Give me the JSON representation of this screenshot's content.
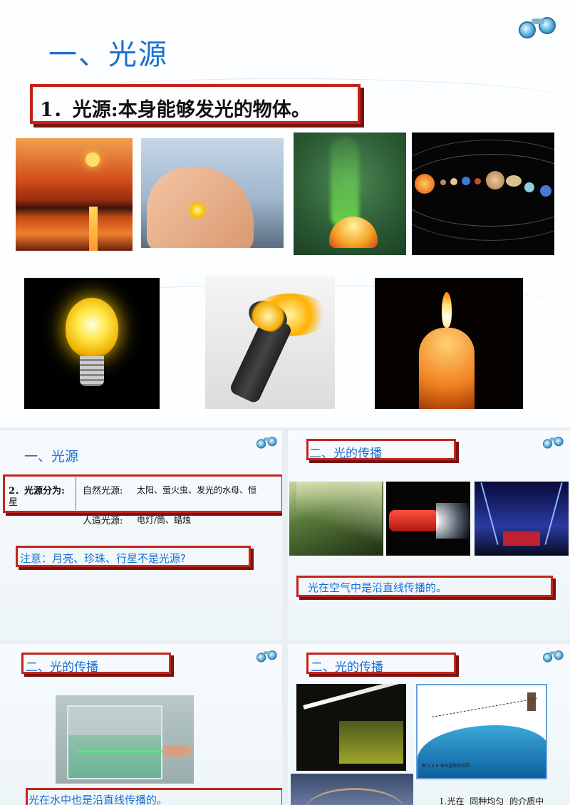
{
  "slide_main": {
    "title": "一、光源",
    "definition": "1．光源:本身能够发光的物体。",
    "photos": [
      {
        "name": "sunset-photo"
      },
      {
        "name": "firefly-photo"
      },
      {
        "name": "jellyfish-photo"
      },
      {
        "name": "solar-system-photo"
      },
      {
        "name": "light-bulb-photo"
      },
      {
        "name": "flashlight-photo"
      },
      {
        "name": "candle-photo"
      }
    ]
  },
  "slide_sources": {
    "title": "一、光源",
    "classification_label": "2．光源分为:",
    "natural_label": "自然光源:",
    "natural_items": "太阳、萤火虫、发光的水母、恒",
    "natural_wrap": "星",
    "artificial_label": "人造光源:",
    "artificial_items": "电灯/筒、蜡烛",
    "note": "注意：月亮、珍珠、行星不是光源?"
  },
  "slide_propagation_air": {
    "title": "二、光的传播",
    "statement": "光在空气中是沿直线传播的。"
  },
  "slide_propagation_water": {
    "title": "二、光的传播",
    "statement": "光在水中也是沿直线传播的。"
  },
  "slide_propagation_medium": {
    "title": "二、光的传播",
    "figure_caption": "图 2.4-9 海市蜃楼的成因",
    "statement_prefix": "1.光在",
    "statement_blank": "同种均匀",
    "statement_suffix": "的介质中"
  },
  "colors": {
    "title_blue": "#1a6fd0",
    "frame_red": "#c3241d",
    "frame_shadow": "#7a120e"
  },
  "icons": [
    "binoculars-icon"
  ]
}
